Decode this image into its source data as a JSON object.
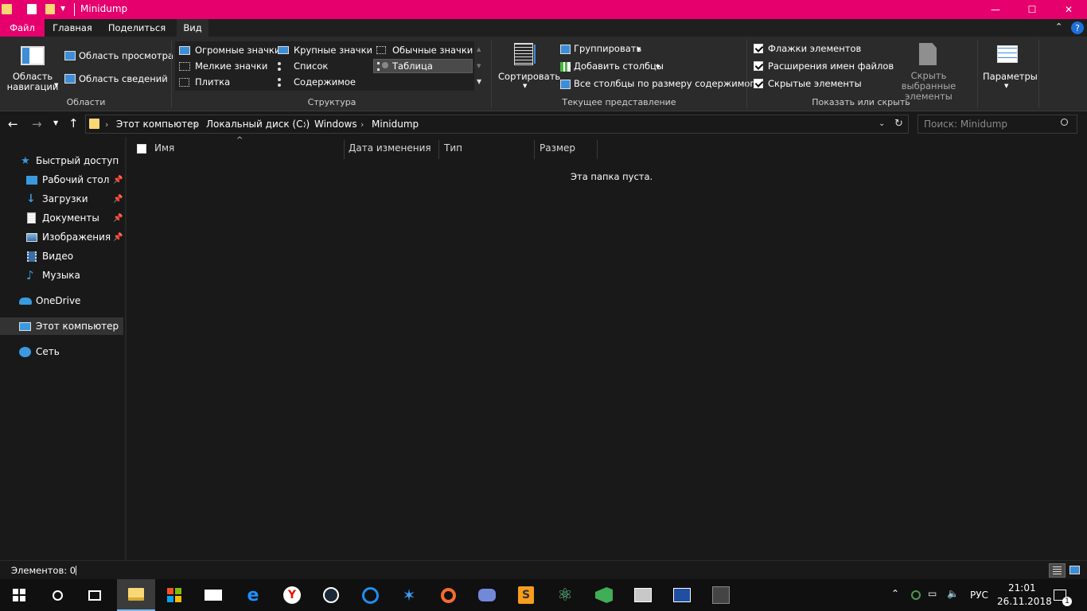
{
  "window": {
    "title": "Minidump",
    "controls": {
      "minimize": "—",
      "maximize": "☐",
      "close": "✕"
    }
  },
  "ribbon_tabs": [
    "Файл",
    "Главная",
    "Поделиться",
    "Вид"
  ],
  "ribbon_help": "?",
  "ribbon": {
    "areas": {
      "nav_pane": "Область навигации",
      "preview_pane": "Область просмотра",
      "details_pane": "Область сведений",
      "group_label": "Области"
    },
    "layout": {
      "options": [
        "Огромные значки",
        "Крупные значки",
        "Обычные значки",
        "Мелкие значки",
        "Список",
        "Таблица",
        "Плитка",
        "Содержимое"
      ],
      "selected": "Таблица",
      "group_label": "Структура"
    },
    "current_view": {
      "sort": "Сортировать",
      "group_by": "Группировать",
      "add_columns": "Добавить столбцы",
      "size_all_columns": "Все столбцы по размеру содержимого",
      "group_label": "Текущее представление"
    },
    "show_hide": {
      "item_checkboxes": "Флажки элементов",
      "file_extensions": "Расширения имен файлов",
      "hidden_items": "Скрытые элементы",
      "hide_selected": "Скрыть выбранные элементы",
      "group_label": "Показать или скрыть"
    },
    "options": "Параметры"
  },
  "address": {
    "crumbs": [
      "Этот компьютер",
      "Локальный диск (C:)",
      "Windows",
      "Minidump"
    ],
    "search_placeholder": "Поиск: Minidump"
  },
  "sidebar": {
    "quick_access": "Быстрый доступ",
    "pinned": [
      "Рабочий стол",
      "Загрузки",
      "Документы",
      "Изображения"
    ],
    "unpinned": [
      "Видео",
      "Музыка"
    ],
    "onedrive": "OneDrive",
    "this_pc": "Этот компьютер",
    "network": "Сеть"
  },
  "columns": [
    "Имя",
    "Дата изменения",
    "Тип",
    "Размер"
  ],
  "empty_message": "Эта папка пуста.",
  "status": "Элементов: 0",
  "tray": {
    "language": "РУС",
    "time": "21:01",
    "date": "26.11.2018",
    "notifications": "1"
  },
  "colors": {
    "accent": "#e6006e",
    "background": "#191919",
    "ribbon": "#2b2b2b",
    "taskbar": "#101010"
  }
}
